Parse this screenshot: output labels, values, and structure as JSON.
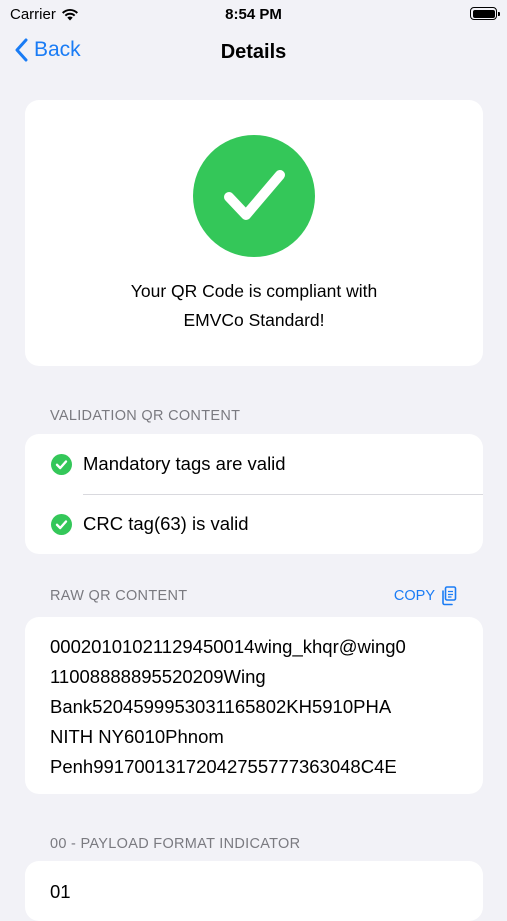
{
  "status_bar": {
    "carrier": "Carrier",
    "time": "8:54 PM"
  },
  "nav": {
    "back_label": "Back",
    "title": "Details"
  },
  "result": {
    "icon": "checkmark-icon",
    "line1": "Your QR Code is compliant with",
    "line2": "EMVCo Standard!",
    "color": "#34c759"
  },
  "validation": {
    "header": "VALIDATION QR CONTENT",
    "items": [
      {
        "label": "Mandatory tags are valid"
      },
      {
        "label": "CRC tag(63) is valid"
      }
    ]
  },
  "raw": {
    "header": "RAW QR CONTENT",
    "copy_label": "COPY",
    "lines": [
      "00020101021129450014wing_khqr@wing0",
      "11008888895520209Wing",
      "Bank5204599953031165802KH5910PHA",
      "NITH NY6010Phnom",
      "Penh99170013172042755777363048C4E"
    ]
  },
  "payload": {
    "header": "00 - PAYLOAD FORMAT INDICATOR",
    "value": "01"
  },
  "colors": {
    "accent": "#1a7cf5",
    "success": "#34c759",
    "background": "#f2f2f7"
  }
}
